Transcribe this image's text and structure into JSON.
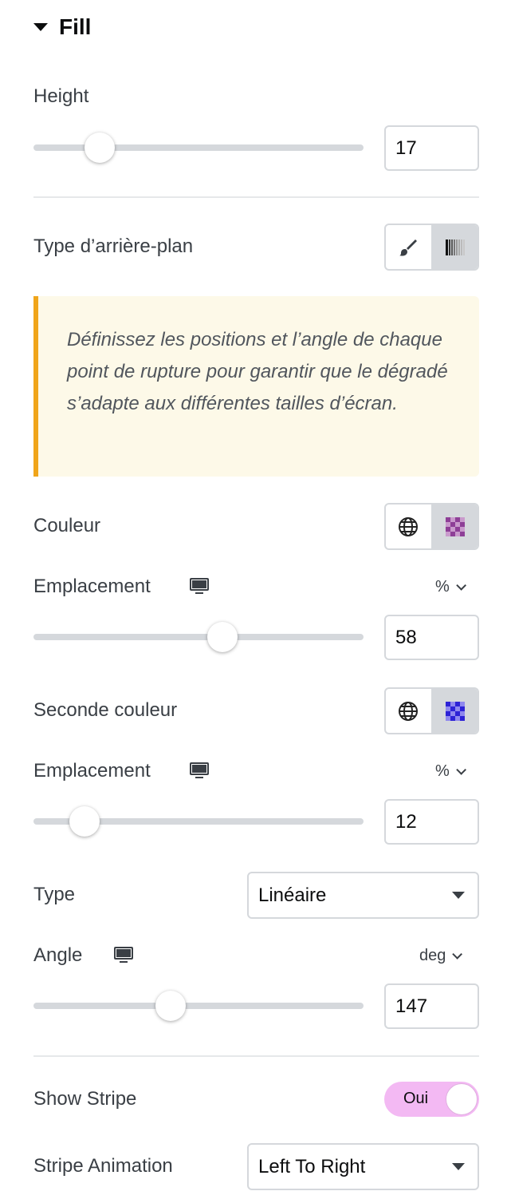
{
  "section": {
    "title": "Fill",
    "expanded": true
  },
  "height": {
    "label": "Height",
    "value": "17",
    "fraction": 0.17
  },
  "background_type": {
    "label": "Type d’arrière-plan",
    "options": [
      "brush-icon",
      "gradient-icon"
    ],
    "selected": "gradient-icon"
  },
  "notice": {
    "text": "Définissez les positions et l’angle de chaque point de rupture pour garantir que le dégradé s’adapte aux différentes tailles d’écran."
  },
  "color1": {
    "label": "Couleur",
    "swatch": "#b05fb8"
  },
  "location1": {
    "label": "Emplacement",
    "unit": "%",
    "value": "58",
    "fraction": 0.58
  },
  "color2": {
    "label": "Seconde couleur",
    "swatch": "#4a3fe0"
  },
  "location2": {
    "label": "Emplacement",
    "unit": "%",
    "value": "12",
    "fraction": 0.12
  },
  "gradient_type": {
    "label": "Type",
    "value": "Linéaire"
  },
  "angle": {
    "label": "Angle",
    "unit": "deg",
    "value": "147",
    "fraction": 0.408
  },
  "show_stripe": {
    "label": "Show Stripe",
    "toggle_text": "Oui",
    "on": true,
    "color": "#f3b9f3"
  },
  "stripe_animation": {
    "label": "Stripe Animation",
    "value": "Left To Right"
  }
}
